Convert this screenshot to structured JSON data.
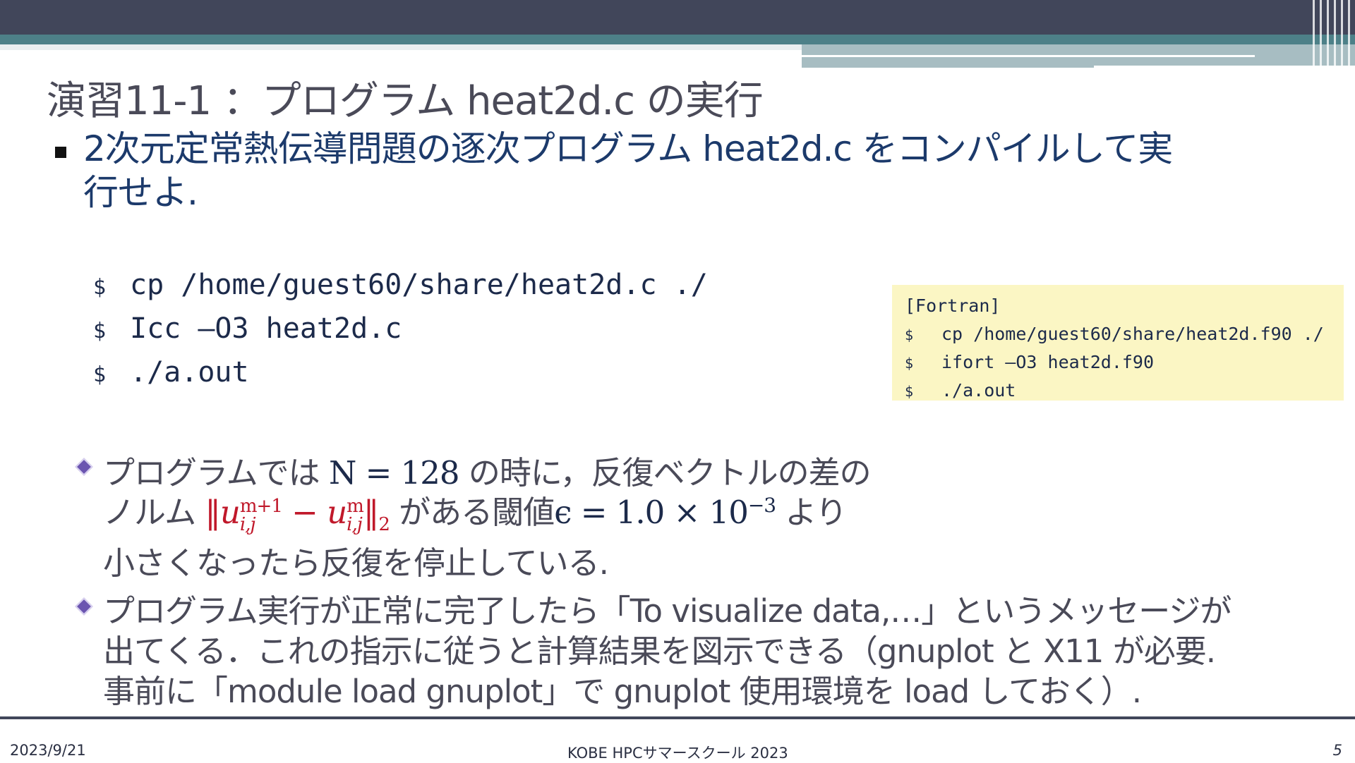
{
  "title": "演習11-1 ：プログラム heat2d.c の実行",
  "main_bullet": {
    "line1": "2次元定常熱伝導問題の逐次プログラム heat2d.c をコンパイルして実",
    "line2": "行せよ."
  },
  "commands": [
    {
      "prompt": "$",
      "code": "cp /home/guest60/share/heat2d.c ./"
    },
    {
      "prompt": "$",
      "code": "Icc –O3 heat2d.c"
    },
    {
      "prompt": "$",
      "code": "./a.out"
    }
  ],
  "fortran_box": {
    "heading": "[Fortran]",
    "commands": [
      {
        "prompt": "$",
        "code": "cp /home/guest60/share/heat2d.f90 ./"
      },
      {
        "prompt": "$",
        "code": "ifort –O3 heat2d.f90"
      },
      {
        "prompt": "$",
        "code": "./a.out"
      }
    ]
  },
  "sub_bullet_1": {
    "line1_pre": "プログラムでは ",
    "line1_math": "N = 128",
    "line1_post": " の時に，反復ベクトルの差の",
    "line2_pre": "ノルム ",
    "line2_norm": "‖u",
    "line2_sup1": "m+1",
    "line2_sub1": "i,j",
    "line2_minus": " − u",
    "line2_sup2": "m",
    "line2_sub2": "i,j",
    "line2_norm_end": "‖",
    "line2_norm_sub": "2",
    "line2_mid": " がある閾値",
    "line2_eps": "ϵ = 1.0 × 10",
    "line2_exp": "−3",
    "line2_post": " より",
    "line3": "小さくなったら反復を停止している."
  },
  "sub_bullet_2": {
    "line1": "プログラム実行が正常に完了したら「To visualize data,…」というメッセージが",
    "line2": "出てくる．これの指示に従うと計算結果を図示できる（gnuplot と X11 が必要.",
    "line3": "事前に「module load gnuplot」で gnuplot 使用環境を load しておく）."
  },
  "footer": {
    "date": "2023/9/21",
    "event": "KOBE HPCサマースクール 2023",
    "page": "5"
  }
}
